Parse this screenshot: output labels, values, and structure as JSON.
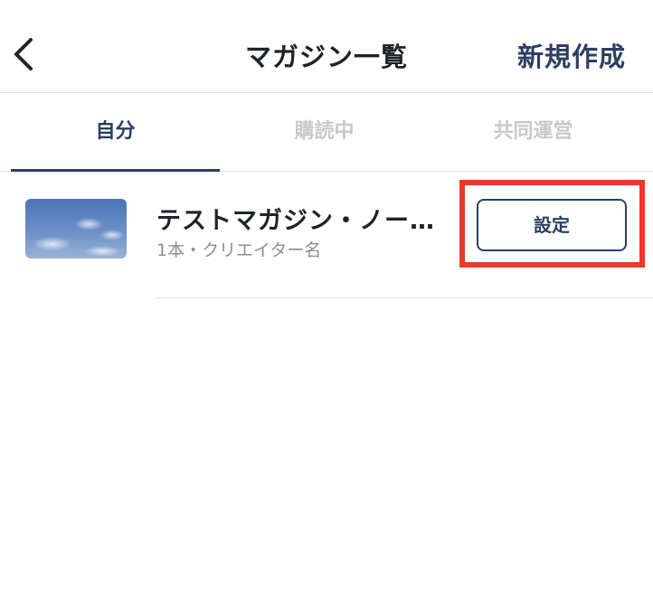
{
  "header": {
    "title": "マガジン一覧",
    "new_label": "新規作成"
  },
  "tabs": [
    {
      "label": "自分",
      "active": true
    },
    {
      "label": "購読中",
      "active": false
    },
    {
      "label": "共同運営",
      "active": false
    }
  ],
  "items": [
    {
      "title": "テストマガジン・ノー…",
      "meta": "1本・クリエイター名",
      "settings_label": "設定"
    }
  ],
  "colors": {
    "accent": "#2c3e64",
    "highlight": "#e8392a",
    "inactive_tab": "#c7c9cc"
  },
  "icons": {
    "back": "chevron-left-icon"
  }
}
